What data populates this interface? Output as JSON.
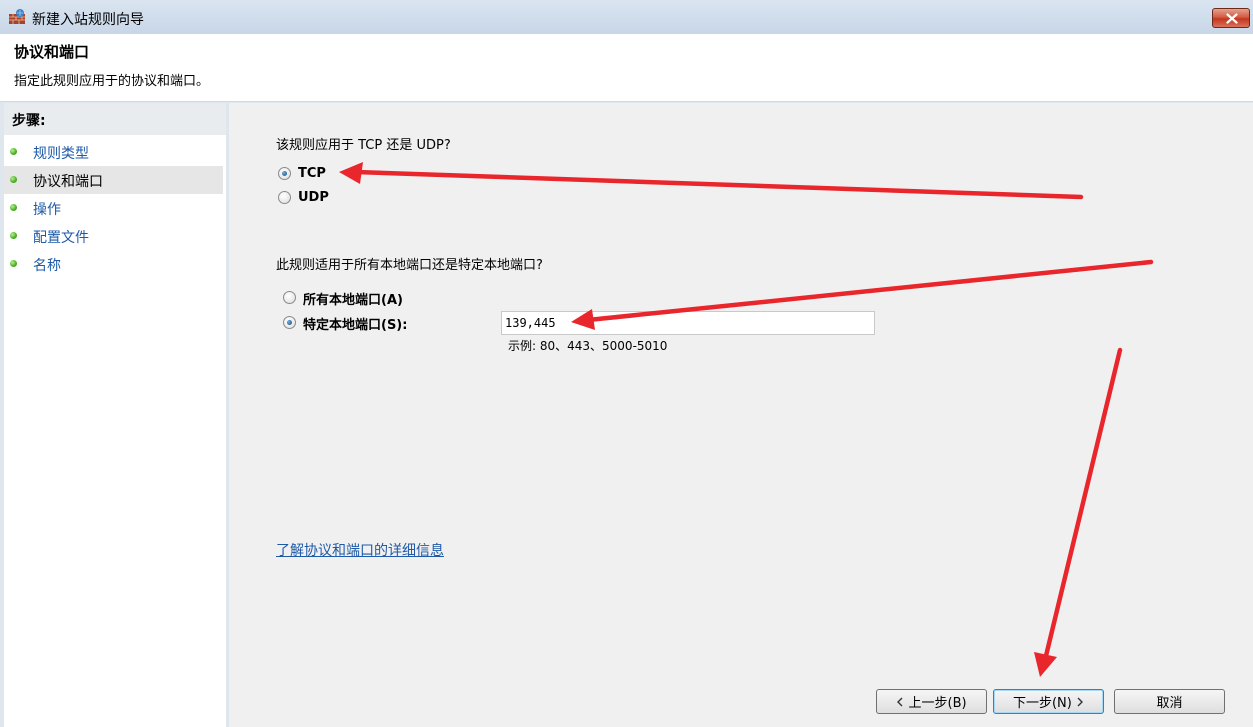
{
  "window": {
    "title": "新建入站规则向导",
    "icon": "firewall-brick-icon"
  },
  "header": {
    "title": "协议和端口",
    "subtitle": "指定此规则应用于的协议和端口。"
  },
  "steps": {
    "title": "步骤:",
    "items": [
      {
        "label": "规则类型"
      },
      {
        "label": "协议和端口"
      },
      {
        "label": "操作"
      },
      {
        "label": "配置文件"
      },
      {
        "label": "名称"
      }
    ],
    "current_index": 1
  },
  "protocol": {
    "question": "该规则应用于 TCP 还是 UDP?",
    "options": [
      "TCP",
      "UDP"
    ],
    "selected": "TCP"
  },
  "ports": {
    "question": "此规则适用于所有本地端口还是特定本地端口?",
    "all_label": "所有本地端口(A)",
    "specific_label": "特定本地端口(S):",
    "selected": "specific",
    "value": "139,445",
    "example": "示例: 80、443、5000-5010"
  },
  "link": {
    "label": "了解协议和端口的详细信息"
  },
  "buttons": {
    "back": "上一步(B)",
    "next": "下一步(N)",
    "cancel": "取消"
  },
  "annotation_color": "#e8262b"
}
